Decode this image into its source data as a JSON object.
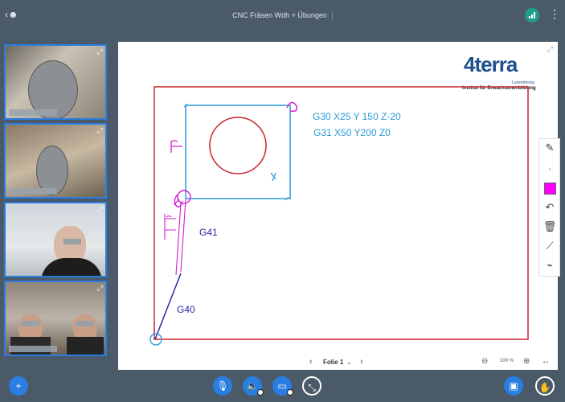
{
  "header": {
    "title": "CNC Fräsen Wdh + Übungen",
    "users_icon": "user-list-icon",
    "connection_icon": "signal-icon",
    "menu_icon": "kebab-menu-icon"
  },
  "webcams": [
    {
      "label": "webcam-1"
    },
    {
      "label": "webcam-2"
    },
    {
      "label": "webcam-3"
    },
    {
      "label": "webcam-4"
    }
  ],
  "slide": {
    "logo_word": "4terra",
    "logo_region": "Luxembourg",
    "logo_subtitle": "Institut für Erwachsenenbildung",
    "line1": "G30 X25 Y 150 Z-20",
    "line2": "G31 X50 Y200 Z0",
    "label_g41": "G41",
    "label_g40": "G40"
  },
  "nav": {
    "slide_label": "Folie 1",
    "zoom": "100 %"
  },
  "colors": {
    "accent": "#2a7de1",
    "teal": "#1f9d8b",
    "pen_blue": "#2b9ad8",
    "pen_red": "#c8232c",
    "pen_magenta": "#d21fd2",
    "pen_navy": "#2b2ba8"
  }
}
